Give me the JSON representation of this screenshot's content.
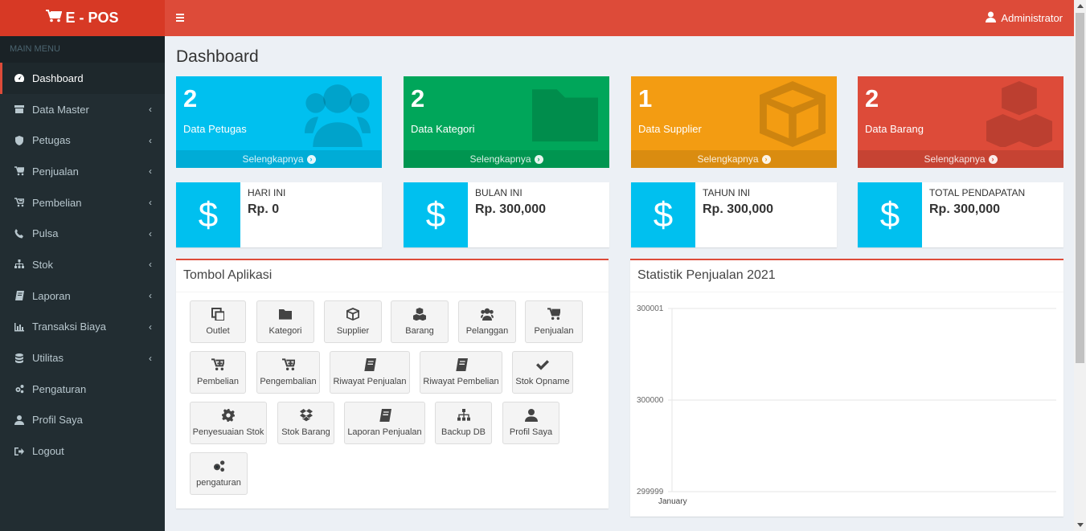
{
  "app": {
    "logo": "E - POS",
    "user": "Administrator"
  },
  "sidebar": {
    "header": "MAIN MENU",
    "items": [
      {
        "label": "Dashboard",
        "icon": "dashboard-icon"
      },
      {
        "label": "Data Master",
        "icon": "archive-icon"
      },
      {
        "label": "Petugas",
        "icon": "shield-icon"
      },
      {
        "label": "Penjualan",
        "icon": "cart-icon"
      },
      {
        "label": "Pembelian",
        "icon": "cart-arrow-icon"
      },
      {
        "label": "Pulsa",
        "icon": "phone-icon"
      },
      {
        "label": "Stok",
        "icon": "sitemap-icon"
      },
      {
        "label": "Laporan",
        "icon": "book-icon"
      },
      {
        "label": "Transaksi Biaya",
        "icon": "chart-icon"
      },
      {
        "label": "Utilitas",
        "icon": "database-icon"
      },
      {
        "label": "Pengaturan",
        "icon": "cogs-icon"
      },
      {
        "label": "Profil Saya",
        "icon": "user-icon"
      },
      {
        "label": "Logout",
        "icon": "sign-out-icon"
      }
    ]
  },
  "page": {
    "title": "Dashboard"
  },
  "stat_boxes": [
    {
      "value": "2",
      "label": "Data Petugas",
      "link": "Selengkapnya",
      "color": "#00c0ef",
      "icon": "users-icon"
    },
    {
      "value": "2",
      "label": "Data Kategori",
      "link": "Selengkapnya",
      "color": "#00a65a",
      "icon": "folder-icon"
    },
    {
      "value": "1",
      "label": "Data Supplier",
      "link": "Selengkapnya",
      "color": "#f39c12",
      "icon": "cube-icon"
    },
    {
      "value": "2",
      "label": "Data Barang",
      "link": "Selengkapnya",
      "color": "#dd4b39",
      "icon": "cubes-icon"
    }
  ],
  "info_boxes": [
    {
      "title": "HARI INI",
      "value": "Rp. 0",
      "symbol": "$"
    },
    {
      "title": "BULAN INI",
      "value": "Rp. 300,000",
      "symbol": "$"
    },
    {
      "title": "TAHUN INI",
      "value": "Rp. 300,000",
      "symbol": "$"
    },
    {
      "title": "TOTAL PENDAPATAN",
      "value": "Rp. 300,000",
      "symbol": "$"
    }
  ],
  "apps_panel": {
    "title": "Tombol Aplikasi",
    "buttons": [
      {
        "label": "Outlet",
        "icon": "clone-icon"
      },
      {
        "label": "Kategori",
        "icon": "folder-icon"
      },
      {
        "label": "Supplier",
        "icon": "cube-icon"
      },
      {
        "label": "Barang",
        "icon": "cubes-icon"
      },
      {
        "label": "Pelanggan",
        "icon": "users-icon"
      },
      {
        "label": "Penjualan",
        "icon": "cart-icon"
      },
      {
        "label": "Pembelian",
        "icon": "cart-plus-icon"
      },
      {
        "label": "Pengembalian",
        "icon": "cart-plus-icon"
      },
      {
        "label": "Riwayat Penjualan",
        "icon": "book-icon"
      },
      {
        "label": "Riwayat Pembelian",
        "icon": "book-icon"
      },
      {
        "label": "Stok Opname",
        "icon": "check-icon"
      },
      {
        "label": "Penyesuaian Stok",
        "icon": "cog-icon"
      },
      {
        "label": "Stok Barang",
        "icon": "dropbox-icon"
      },
      {
        "label": "Laporan Penjualan",
        "icon": "book-icon"
      },
      {
        "label": "Backup DB",
        "icon": "sitemap-icon"
      },
      {
        "label": "Profil Saya",
        "icon": "user-icon"
      },
      {
        "label": "pengaturan",
        "icon": "cogs-icon"
      }
    ]
  },
  "chart_panel": {
    "title": "Statistik Penjualan 2021"
  },
  "chart_data": {
    "type": "line",
    "title": "Statistik Penjualan 2021",
    "categories": [
      "January"
    ],
    "series": [
      {
        "values": [
          300000
        ]
      }
    ],
    "y_ticks": [
      "300001",
      "300000",
      "299999"
    ],
    "ylim": [
      299999,
      300001
    ],
    "grid": true
  }
}
